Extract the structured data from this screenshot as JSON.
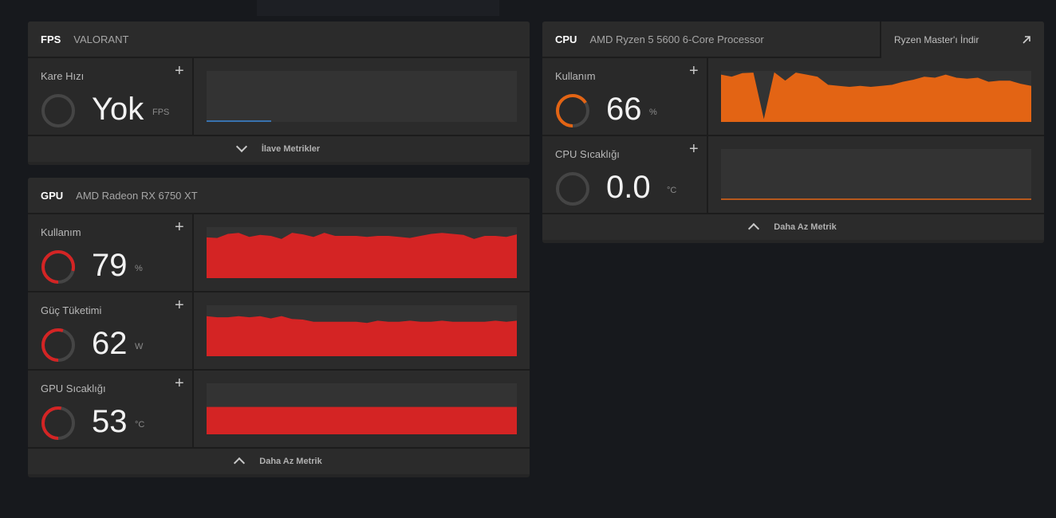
{
  "fps": {
    "title": "FPS",
    "subtitle": "VALORANT",
    "metric": {
      "label": "Kare Hızı",
      "value": "Yok",
      "unit": "FPS"
    },
    "footer": "İlave Metrikler"
  },
  "gpu": {
    "title": "GPU",
    "subtitle": "AMD Radeon RX 6750 XT",
    "metrics": [
      {
        "label": "Kullanım",
        "value": "79",
        "unit": "%",
        "gauge_fraction": 0.79,
        "color": "#d42424",
        "series": [
          79,
          78,
          86,
          88,
          80,
          84,
          82,
          76,
          88,
          85,
          80,
          88,
          82,
          82,
          82,
          80,
          82,
          82,
          80,
          78,
          82,
          86,
          88,
          86,
          84,
          76,
          82,
          82,
          80,
          85
        ]
      },
      {
        "label": "Güç Tüketimi",
        "value": "62",
        "unit": "W",
        "gauge_fraction": 0.55,
        "color": "#d42424",
        "series": [
          70,
          68,
          68,
          70,
          68,
          70,
          66,
          70,
          65,
          64,
          60,
          60,
          60,
          60,
          60,
          58,
          62,
          60,
          60,
          62,
          60,
          60,
          62,
          60,
          60,
          60,
          60,
          62,
          60,
          62
        ]
      },
      {
        "label": "GPU Sıcaklığı",
        "value": "53",
        "unit": "°C",
        "gauge_fraction": 0.53,
        "color": "#d42424",
        "series": [
          53,
          53,
          53,
          53,
          53,
          53,
          53,
          53,
          53,
          53,
          53,
          53,
          53,
          53,
          53,
          53,
          53,
          53,
          53,
          53,
          53,
          53,
          53,
          53,
          53,
          53,
          53,
          53,
          53,
          53
        ]
      }
    ],
    "footer": "Daha Az Metrik"
  },
  "cpu": {
    "title": "CPU",
    "subtitle": "AMD Ryzen 5 5600 6-Core Processor",
    "ryzen_link": "Ryzen Master'ı İndir",
    "metrics": [
      {
        "label": "Kullanım",
        "value": "66",
        "unit": "%",
        "gauge_fraction": 0.66,
        "color": "#e36414",
        "series": [
          92,
          88,
          95,
          96,
          2,
          96,
          80,
          96,
          92,
          88,
          72,
          70,
          68,
          70,
          68,
          70,
          72,
          78,
          82,
          88,
          86,
          92,
          86,
          84,
          86,
          78,
          80,
          80,
          74,
          70
        ]
      },
      {
        "label": "CPU Sıcaklığı",
        "value": "0.0",
        "unit": "°C",
        "gauge_fraction": 0.0,
        "color": "#e36414",
        "series": [
          0,
          0,
          0,
          0,
          0,
          0,
          0,
          0,
          0,
          0,
          0,
          0,
          0,
          0,
          0,
          0,
          0,
          0,
          0,
          0,
          0,
          0,
          0,
          0,
          0,
          0,
          0,
          0,
          0,
          0
        ]
      }
    ],
    "footer": "Daha Az Metrik"
  }
}
